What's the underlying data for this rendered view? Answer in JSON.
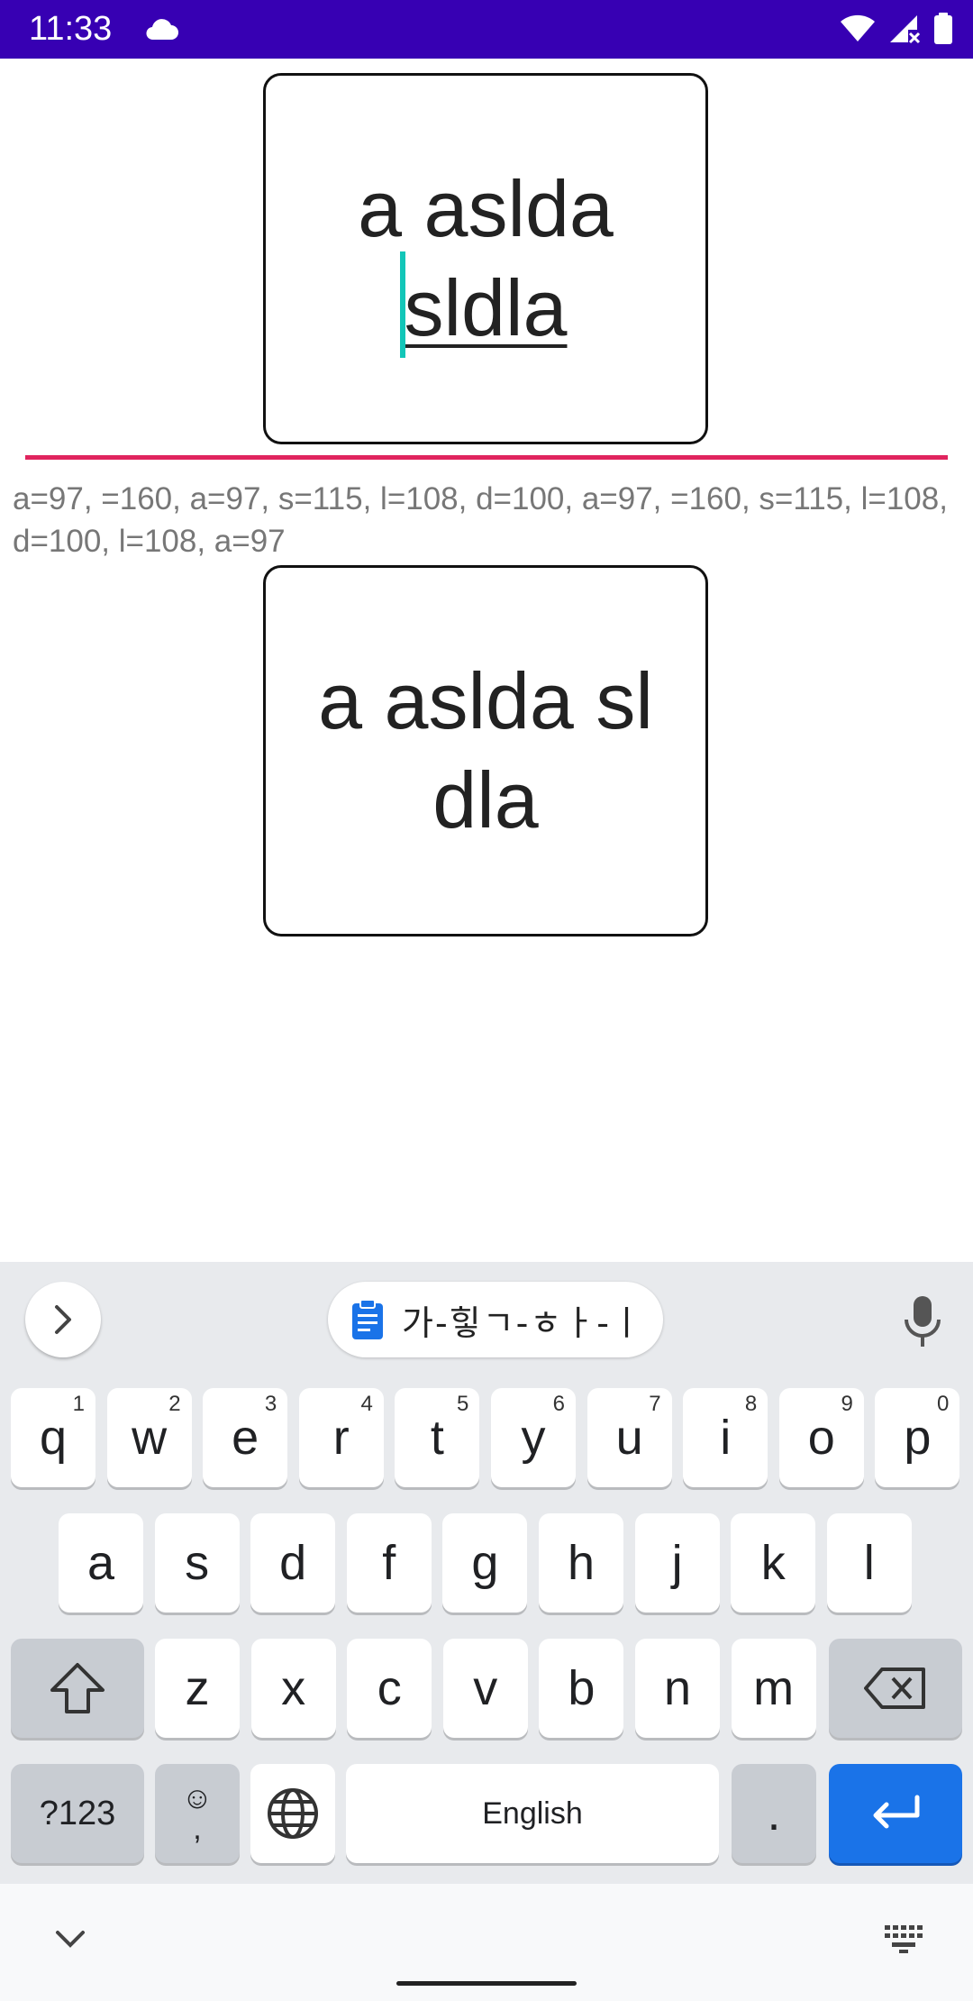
{
  "status_bar": {
    "time": "11:33",
    "cloud_icon": "cloud-icon",
    "wifi_icon": "wifi-icon",
    "signal_icon": "signal-no-data-icon",
    "battery_icon": "battery-icon",
    "background_color": "#3700B3"
  },
  "edit_box": {
    "line1": "a aslda",
    "line2": "sldla",
    "cursor_color": "#12c6b8"
  },
  "rule_color": "#E0245E",
  "char_codes": "a=97,  =160, a=97, s=115, l=108, d=100, a=97,  =160, s=115, l=108, d=100, l=108, a=97",
  "display_box": {
    "line1": "a aslda sl",
    "line2": "dla"
  },
  "keyboard": {
    "clipboard_text": "가-힣ㄱ-ㅎㅏ-ㅣ",
    "row1": [
      {
        "label": "q",
        "hint": "1"
      },
      {
        "label": "w",
        "hint": "2"
      },
      {
        "label": "e",
        "hint": "3"
      },
      {
        "label": "r",
        "hint": "4"
      },
      {
        "label": "t",
        "hint": "5"
      },
      {
        "label": "y",
        "hint": "6"
      },
      {
        "label": "u",
        "hint": "7"
      },
      {
        "label": "i",
        "hint": "8"
      },
      {
        "label": "o",
        "hint": "9"
      },
      {
        "label": "p",
        "hint": "0"
      }
    ],
    "row2": [
      "a",
      "s",
      "d",
      "f",
      "g",
      "h",
      "j",
      "k",
      "l"
    ],
    "row3": [
      "z",
      "x",
      "c",
      "v",
      "b",
      "n",
      "m"
    ],
    "symbols_label": "?123",
    "emoji_top": "☺",
    "comma_label": ",",
    "space_label": "English",
    "period_label": ".",
    "enter_color": "#1a73e8"
  }
}
